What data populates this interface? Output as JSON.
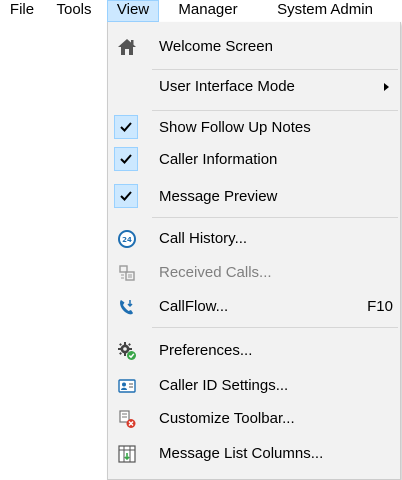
{
  "menubar": {
    "items": [
      {
        "label": "File"
      },
      {
        "label": "Tools"
      },
      {
        "label": "View"
      },
      {
        "label": "Manager"
      },
      {
        "label": "System Admin"
      }
    ]
  },
  "view_menu": {
    "items": [
      {
        "label": "Welcome Screen",
        "icon": "home-icon"
      },
      {
        "label": "User Interface Mode",
        "submenu": true
      },
      {
        "label": "Show Follow Up Notes",
        "checked": true
      },
      {
        "label": "Caller Information",
        "checked": true
      },
      {
        "label": "Message Preview",
        "checked": true
      },
      {
        "label": "Call History...",
        "icon": "call-history-24-icon"
      },
      {
        "label": "Received Calls...",
        "icon": "received-calls-icon",
        "disabled": true
      },
      {
        "label": "CallFlow...",
        "icon": "callflow-phone-icon",
        "shortcut": "F10"
      },
      {
        "label": "Preferences...",
        "icon": "preferences-gear-icon"
      },
      {
        "label": "Caller ID Settings...",
        "icon": "caller-id-card-icon"
      },
      {
        "label": "Customize Toolbar...",
        "icon": "customize-toolbar-icon"
      },
      {
        "label": "Message List Columns...",
        "icon": "message-list-columns-icon"
      }
    ]
  },
  "colors": {
    "menu_bg": "#f2f2f2",
    "highlight": "#cce8ff",
    "highlight_border": "#99d1ff",
    "disabled_text": "#7f7f7f",
    "icon_blue": "#1f6fb2",
    "icon_green": "#3aa64a",
    "icon_red": "#d83b2b"
  }
}
